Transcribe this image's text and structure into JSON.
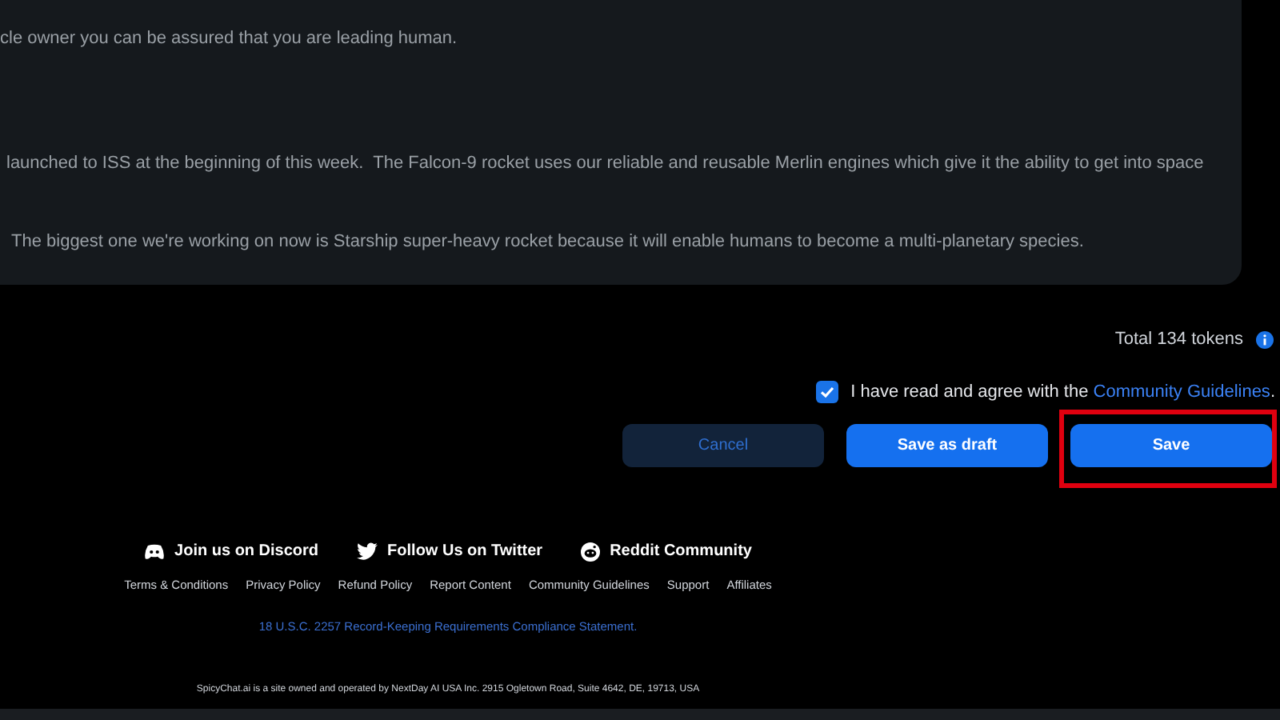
{
  "message_card": {
    "lines": [
      "cle owner you can be assured that you are leading human.",
      "launched to ISS at the beginning of this week.  The Falcon-9 rocket uses our reliable and reusable Merlin engines which give it the ability to get into space",
      "The biggest one we're working on now is Starship super-heavy rocket because it will enable humans to become a multi-planetary species."
    ]
  },
  "token_count": "Total 134 tokens",
  "agreement": {
    "checked": true,
    "text": "I have read and agree with the ",
    "link": "Community Guidelines",
    "end": "."
  },
  "buttons": [
    {
      "label": "Cancel",
      "kind": "secondary",
      "highlighted": false
    },
    {
      "label": "Save as draft",
      "kind": "primary",
      "highlighted": false
    },
    {
      "label": "Save",
      "kind": "primary",
      "highlighted": true
    }
  ],
  "footer": {
    "social": [
      {
        "label": "Join us on Discord",
        "kind": "discord"
      },
      {
        "label": "Follow Us on Twitter",
        "kind": "twitter"
      },
      {
        "label": "Reddit Community",
        "kind": "reddit"
      }
    ],
    "links": [
      "Terms & Conditions",
      "Privacy Policy",
      "Refund Policy",
      "Report Content",
      "Community Guidelines",
      "Support",
      "Affiliates"
    ],
    "statement": "18 U.S.C. 2257 Record-Keeping Requirements Compliance Statement.",
    "ownership": "SpicyChat.ai is a site owned and operated by NextDay AI USA Inc. 2915 Ogletown Road, Suite 4642, DE, 19713, USA"
  }
}
